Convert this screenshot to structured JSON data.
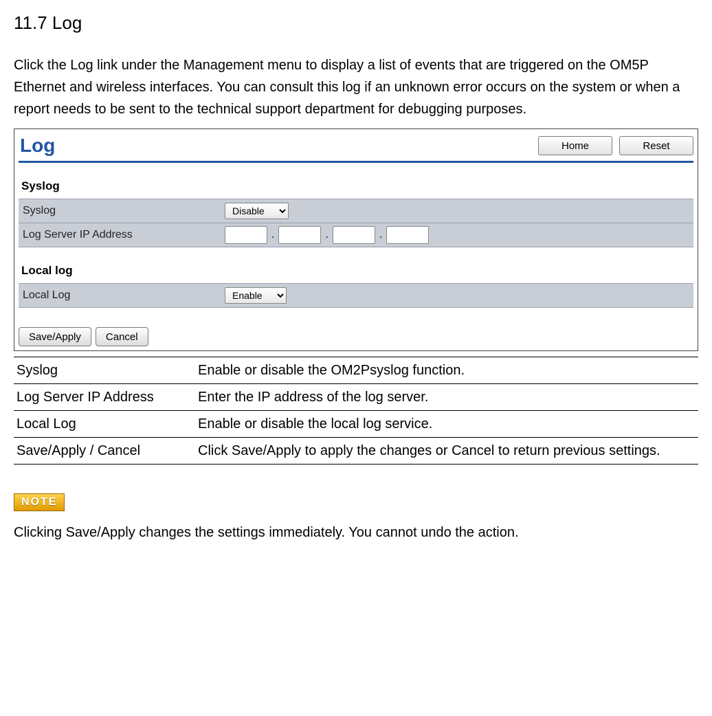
{
  "heading": "11.7 Log",
  "intro": "Click the Log link under the Management menu to display a list of events that are triggered on the OM5P Ethernet and wireless interfaces. You can consult this log if an unknown error occurs on the system or when a report needs to be sent to the technical support department for debugging purposes.",
  "screenshot": {
    "title": "Log",
    "home_btn": "Home",
    "reset_btn": "Reset",
    "subhead_syslog": "Syslog",
    "row_syslog_label": "Syslog",
    "row_syslog_value": "Disable",
    "row_ip_label": "Log Server IP Address",
    "ip": {
      "a": "",
      "b": "",
      "c": "",
      "d": ""
    },
    "subhead_local": "Local log",
    "row_local_label": "Local Log",
    "row_local_value": "Enable",
    "save_btn": "Save/Apply",
    "cancel_btn": "Cancel"
  },
  "table": {
    "r1t": "Syslog",
    "r1d": "Enable or disable the OM2Psyslog function.",
    "r2t": "Log Server IP Address",
    "r2d": "Enter the IP address of the log server.",
    "r3t": "Local Log",
    "r3d": "Enable or disable the local log service.",
    "r4t": "Save/Apply / Cancel",
    "r4d": "Click Save/Apply to apply the changes or Cancel to return previous settings."
  },
  "note_badge": "NOTE",
  "note_text": "Clicking Save/Apply changes the settings immediately. You cannot undo the action."
}
